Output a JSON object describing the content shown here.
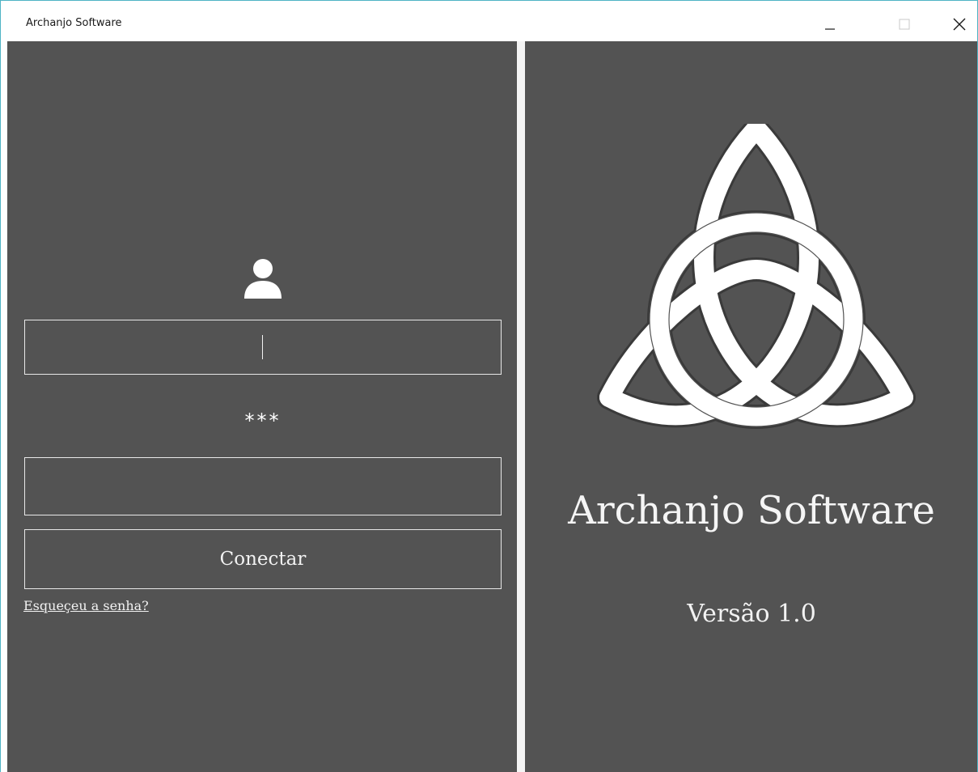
{
  "window": {
    "title": "Archanjo Software",
    "controls": {
      "minimize_icon": "minimize-icon",
      "maximize_icon": "maximize-icon",
      "close_icon": "close-icon"
    }
  },
  "login": {
    "user_icon": "user-icon",
    "username": {
      "value": "",
      "placeholder": ""
    },
    "password_label": "***",
    "password": {
      "value": "",
      "placeholder": ""
    },
    "connect_label": "Conectar",
    "forgot_label": "Esqueçeu a senha?"
  },
  "brand": {
    "logo_icon": "triquetra-icon",
    "name": "Archanjo Software",
    "version": "Versão 1.0"
  },
  "colors": {
    "panel_bg": "#535353",
    "divider": "#f4f4f4",
    "text": "#f5f5f5",
    "window_border": "#4fb3c4"
  }
}
